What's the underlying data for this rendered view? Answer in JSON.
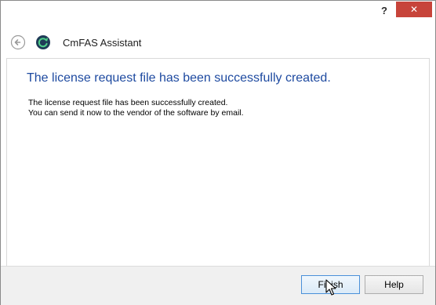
{
  "window": {
    "help_glyph": "?",
    "close_glyph": "✕"
  },
  "header": {
    "title": "CmFAS Assistant"
  },
  "content": {
    "headline": "The license request file has been successfully created.",
    "lines": [
      "The license request file has been successfully created.",
      "You can send it now to the vendor of the software by email."
    ]
  },
  "footer": {
    "finish_label": "Finish",
    "help_label": "Help"
  },
  "colors": {
    "accent": "#1e4aa0",
    "close": "#c7443a",
    "app_icon": "#1f3b57"
  },
  "icons": {
    "back": "back-arrow-icon",
    "app": "app-logo-icon",
    "cursor": "mouse-cursor-icon"
  }
}
